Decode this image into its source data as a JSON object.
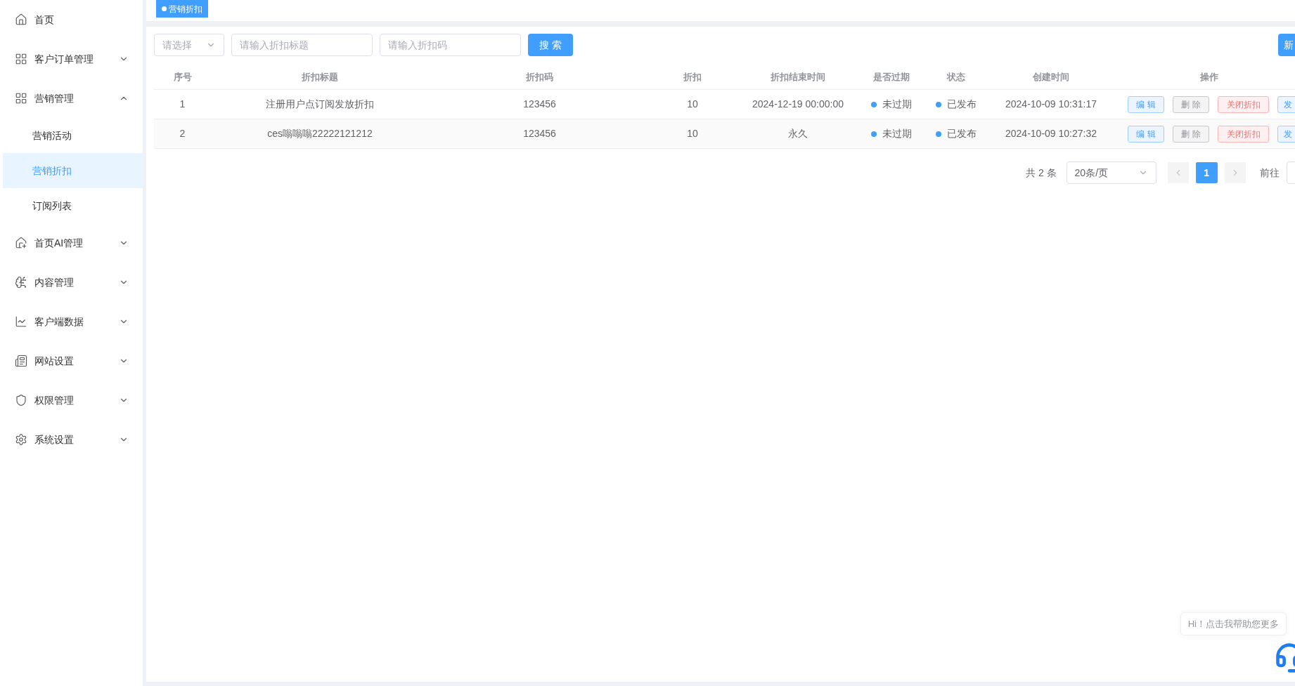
{
  "sidebar": {
    "items": [
      {
        "label": "首页"
      },
      {
        "label": "客户订单管理",
        "expanded": false
      },
      {
        "label": "营销管理",
        "expanded": true,
        "children": [
          {
            "label": "营销活动",
            "selected": false
          },
          {
            "label": "营销折扣",
            "selected": true
          },
          {
            "label": "订阅列表",
            "selected": false
          }
        ]
      },
      {
        "label": "首页AI管理",
        "expanded": false
      },
      {
        "label": "内容管理",
        "expanded": false
      },
      {
        "label": "客户端数据",
        "expanded": false
      },
      {
        "label": "网站设置",
        "expanded": false
      },
      {
        "label": "权限管理",
        "expanded": false
      },
      {
        "label": "系统设置",
        "expanded": false
      }
    ]
  },
  "tags": [
    {
      "label": "营销折扣",
      "selected": true
    }
  ],
  "filters": {
    "select": {
      "placeholder": "请选择"
    },
    "title_input": {
      "placeholder": "请输入折扣标题"
    },
    "code_input": {
      "placeholder": "请输入折扣码"
    },
    "search_button": "搜 索",
    "add_button": "新"
  },
  "table": {
    "columns": [
      "序号",
      "折扣标题",
      "折扣码",
      "折扣",
      "折扣结束时间",
      "是否过期",
      "状态",
      "创建时间",
      "操作"
    ],
    "rows": [
      {
        "cells": [
          "1",
          "注册用户点订阅发放折扣",
          "123456",
          "10",
          "2024-12-19 00:00:00"
        ],
        "expired": "未过期",
        "status": "已发布",
        "created": "2024-10-09 10:31:17",
        "actions": [
          "编 辑",
          "删 除",
          "关闭折扣",
          "发"
        ]
      },
      {
        "cells": [
          "2",
          "ces嗡嗡嗡22222121212",
          "123456",
          "10",
          "永久"
        ],
        "expired": "未过期",
        "status": "已发布",
        "created": "2024-10-09 10:27:32",
        "actions": [
          "编 辑",
          "删 除",
          "关闭折扣",
          "发"
        ]
      }
    ]
  },
  "pagination": {
    "total": "共 2 条",
    "page_size": "20条/页",
    "pages": [
      {
        "label": "1",
        "selected": true
      }
    ],
    "goto": "前往"
  },
  "chat": {
    "bubble": "Hi！点击我帮助您更多"
  }
}
